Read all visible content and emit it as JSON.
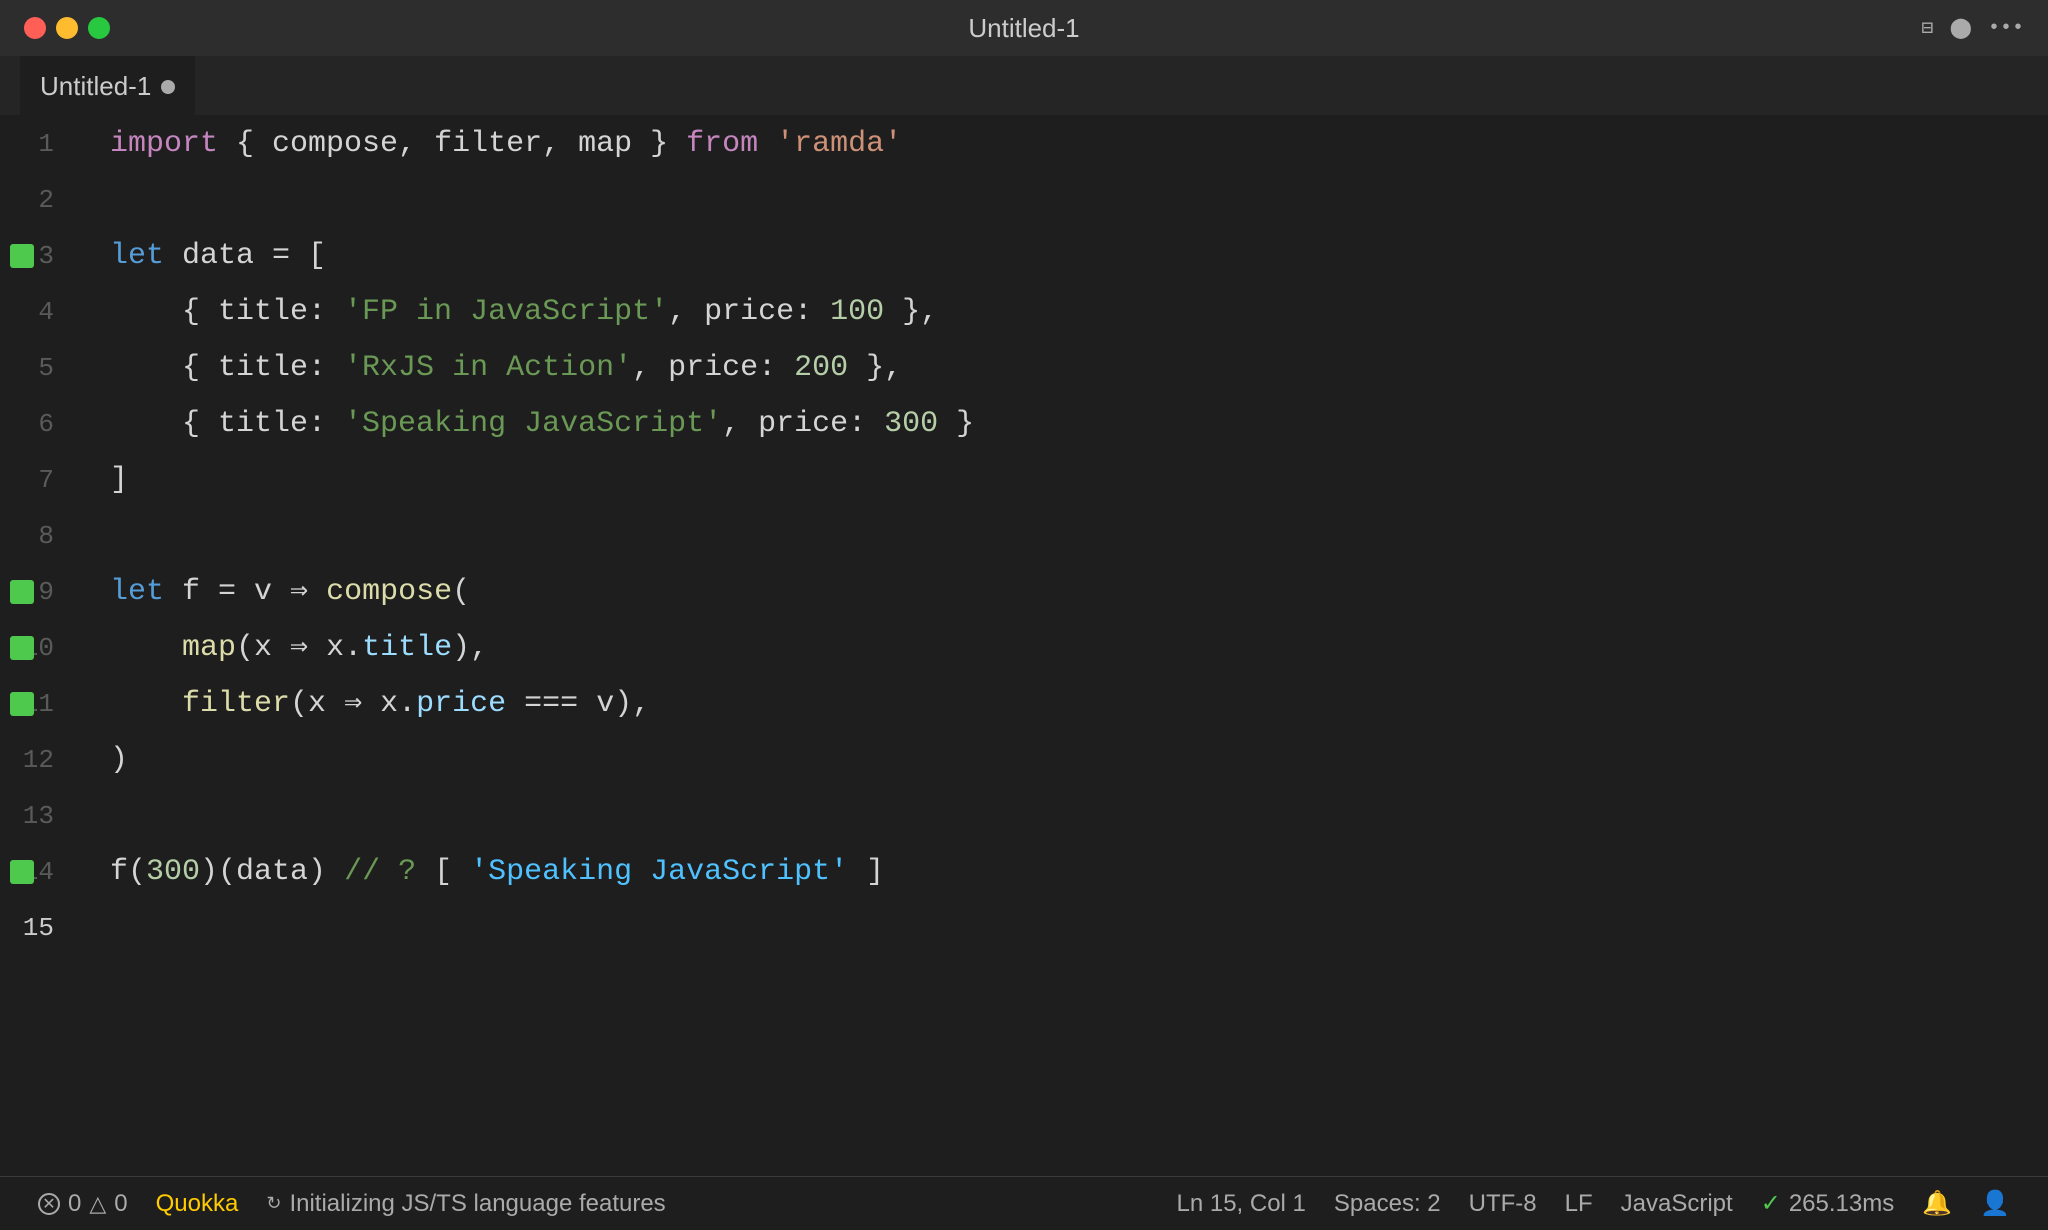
{
  "titlebar": {
    "title": "Untitled-1",
    "buttons": {
      "close": "close",
      "minimize": "minimize",
      "maximize": "maximize"
    }
  },
  "tab": {
    "label": "Untitled-1",
    "has_dot": true
  },
  "code": {
    "lines": [
      {
        "num": "1",
        "active": false,
        "has_breakpoint": false,
        "tokens": [
          {
            "type": "kw-import",
            "text": "import"
          },
          {
            "type": "plain",
            "text": " { compose, filter, map } "
          },
          {
            "type": "kw-from",
            "text": "from"
          },
          {
            "type": "plain",
            "text": " "
          },
          {
            "type": "str",
            "text": "'ramda'"
          }
        ]
      },
      {
        "num": "2",
        "active": false,
        "has_breakpoint": false,
        "tokens": []
      },
      {
        "num": "3",
        "active": false,
        "has_breakpoint": true,
        "tokens": [
          {
            "type": "kw-let",
            "text": "let"
          },
          {
            "type": "plain",
            "text": " data = ["
          }
        ]
      },
      {
        "num": "4",
        "active": false,
        "has_breakpoint": false,
        "tokens": [
          {
            "type": "plain",
            "text": "    { title: "
          },
          {
            "type": "str-green",
            "text": "'FP in JavaScript'"
          },
          {
            "type": "plain",
            "text": ", price: "
          },
          {
            "type": "num",
            "text": "100"
          },
          {
            "type": "plain",
            "text": " },"
          }
        ]
      },
      {
        "num": "5",
        "active": false,
        "has_breakpoint": false,
        "tokens": [
          {
            "type": "plain",
            "text": "    { title: "
          },
          {
            "type": "str-green",
            "text": "'RxJS in Action'"
          },
          {
            "type": "plain",
            "text": ", price: "
          },
          {
            "type": "num",
            "text": "200"
          },
          {
            "type": "plain",
            "text": " },"
          }
        ]
      },
      {
        "num": "6",
        "active": false,
        "has_breakpoint": false,
        "tokens": [
          {
            "type": "plain",
            "text": "    { title: "
          },
          {
            "type": "str-green",
            "text": "'Speaking JavaScript'"
          },
          {
            "type": "plain",
            "text": ", price: "
          },
          {
            "type": "num",
            "text": "300"
          },
          {
            "type": "plain",
            "text": " }"
          }
        ]
      },
      {
        "num": "7",
        "active": false,
        "has_breakpoint": false,
        "tokens": [
          {
            "type": "plain",
            "text": "]"
          }
        ]
      },
      {
        "num": "8",
        "active": false,
        "has_breakpoint": false,
        "tokens": []
      },
      {
        "num": "9",
        "active": false,
        "has_breakpoint": true,
        "tokens": [
          {
            "type": "kw-let",
            "text": "let"
          },
          {
            "type": "plain",
            "text": " f = v "
          },
          {
            "type": "arrow",
            "text": "⇒"
          },
          {
            "type": "plain",
            "text": " "
          },
          {
            "type": "fn-yellow",
            "text": "compose"
          },
          {
            "type": "plain",
            "text": "("
          }
        ]
      },
      {
        "num": "10",
        "active": false,
        "has_breakpoint": true,
        "tokens": [
          {
            "type": "plain",
            "text": "    "
          },
          {
            "type": "fn-yellow",
            "text": "map"
          },
          {
            "type": "plain",
            "text": "(x "
          },
          {
            "type": "arrow",
            "text": "⇒"
          },
          {
            "type": "plain",
            "text": " x."
          },
          {
            "type": "prop",
            "text": "title"
          },
          {
            "type": "plain",
            "text": "),"
          }
        ]
      },
      {
        "num": "11",
        "active": false,
        "has_breakpoint": true,
        "tokens": [
          {
            "type": "plain",
            "text": "    "
          },
          {
            "type": "fn-yellow",
            "text": "filter"
          },
          {
            "type": "plain",
            "text": "(x "
          },
          {
            "type": "arrow",
            "text": "⇒"
          },
          {
            "type": "plain",
            "text": " x."
          },
          {
            "type": "prop",
            "text": "price"
          },
          {
            "type": "plain",
            "text": " "
          },
          {
            "type": "op",
            "text": "==="
          },
          {
            "type": "plain",
            "text": " v),"
          }
        ]
      },
      {
        "num": "12",
        "active": false,
        "has_breakpoint": false,
        "tokens": [
          {
            "type": "plain",
            "text": ")"
          }
        ]
      },
      {
        "num": "13",
        "active": false,
        "has_breakpoint": false,
        "tokens": []
      },
      {
        "num": "14",
        "active": false,
        "has_breakpoint": true,
        "tokens": [
          {
            "type": "plain",
            "text": "f("
          },
          {
            "type": "num",
            "text": "300"
          },
          {
            "type": "plain",
            "text": ")(data) "
          },
          {
            "type": "comment",
            "text": "// ? "
          },
          {
            "type": "plain",
            "text": "[ "
          },
          {
            "type": "result",
            "text": "'Speaking JavaScript'"
          },
          {
            "type": "plain",
            "text": " ]"
          }
        ]
      },
      {
        "num": "15",
        "active": true,
        "has_breakpoint": false,
        "tokens": []
      }
    ]
  },
  "statusbar": {
    "errors": "0",
    "warnings": "0",
    "quokka_label": "Quokka",
    "status_text": "Initializing JS/TS language features",
    "position": "Ln 15, Col 1",
    "spaces": "Spaces: 2",
    "encoding": "UTF-8",
    "line_ending": "LF",
    "language": "JavaScript",
    "timing": "✓ 265.13ms",
    "sync_icon": "↻"
  }
}
